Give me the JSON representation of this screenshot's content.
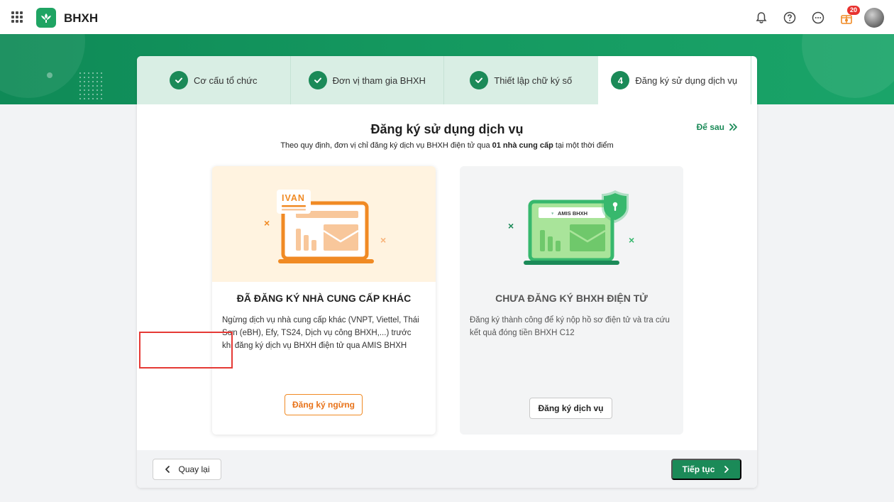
{
  "header": {
    "brand": "BHXH",
    "notification_count": "20"
  },
  "steps": [
    {
      "label": "Cơ cấu tổ chức",
      "done": true
    },
    {
      "label": "Đơn vị tham gia BHXH",
      "done": true
    },
    {
      "label": "Thiết lập chữ ký số",
      "done": true
    },
    {
      "label": "Đăng ký sử dụng dịch vụ",
      "number": "4",
      "active": true
    }
  ],
  "main": {
    "title": "Đăng ký sử dụng dịch vụ",
    "later_label": "Để sau",
    "subtitle_prefix": "Theo quy định, đơn vị chỉ đăng ký dịch vụ BHXH điện tử qua ",
    "subtitle_bold": "01 nhà cung cấp",
    "subtitle_suffix": " tại một thời điểm"
  },
  "options": [
    {
      "illustration_label": "IVAN",
      "title": "ĐÃ ĐĂNG KÝ NHÀ CUNG CẤP KHÁC",
      "description": "Ngừng dịch vụ nhà cung cấp khác (VNPT, Viettel, Thái Sơn (eBH), Efy, TS24, Dịch vụ công BHXH,...) trước khi đăng ký dịch vụ BHXH điện tử qua AMIS BHXH",
      "button": "Đăng ký ngừng"
    },
    {
      "illustration_label": "AMIS BHXH",
      "title": "CHƯA ĐĂNG KÝ BHXH ĐIỆN TỬ",
      "description": "Đăng ký thành công để ký nộp hồ sơ điện tử và tra cứu kết quả đóng tiền BHXH C12",
      "button": "Đăng ký dịch vụ"
    }
  ],
  "footer": {
    "back_label": "Quay lại",
    "next_label": "Tiếp tục"
  },
  "colors": {
    "brand_green": "#1b8a58",
    "accent_orange": "#f08a24",
    "highlight_red": "#e53935"
  }
}
